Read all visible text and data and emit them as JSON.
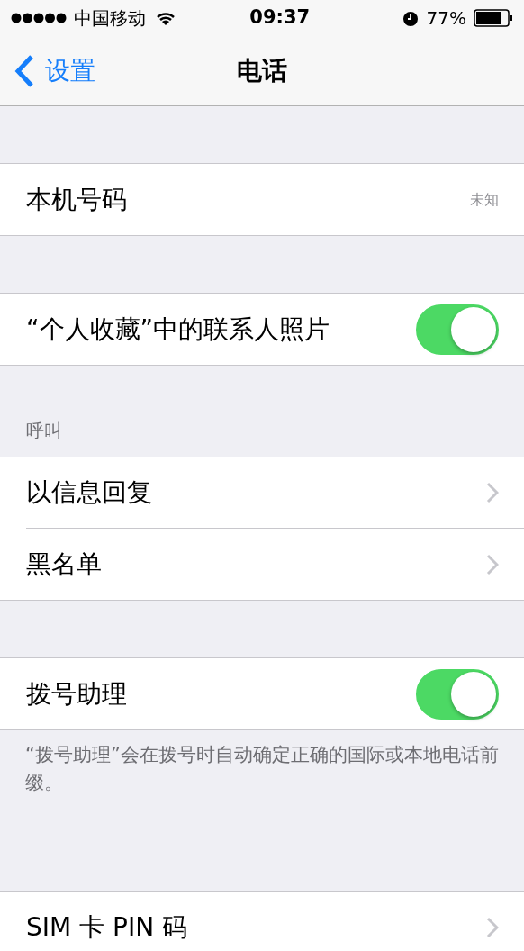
{
  "status_bar": {
    "carrier": "中国移动",
    "time": "09:37",
    "battery": "77%"
  },
  "nav": {
    "back": "设置",
    "title": "电话"
  },
  "sections": [
    {
      "rows": [
        {
          "kind": "value",
          "label": "本机号码",
          "value": "未知"
        }
      ]
    },
    {
      "rows": [
        {
          "kind": "toggle",
          "label": "“个人收藏”中的联系人照片",
          "on": true
        }
      ]
    },
    {
      "header": "呼叫",
      "rows": [
        {
          "kind": "disclosure",
          "label": "以信息回复"
        },
        {
          "kind": "disclosure",
          "label": "黑名单"
        }
      ]
    },
    {
      "rows": [
        {
          "kind": "toggle",
          "label": "拨号助理",
          "on": true
        }
      ],
      "footer": "“拨号助理”会在拨号时自动确定正确的国际或本地电话前缀。"
    },
    {
      "rows": [
        {
          "kind": "disclosure",
          "label": "SIM 卡 PIN 码"
        }
      ]
    }
  ]
}
